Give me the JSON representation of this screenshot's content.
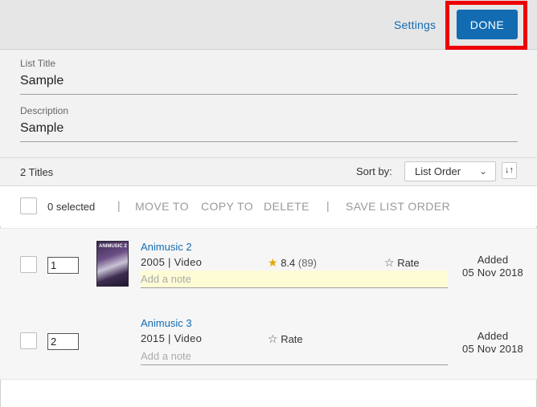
{
  "header": {
    "settings_label": "Settings",
    "done_label": "DONE"
  },
  "list": {
    "title_label": "List Title",
    "title_value": "Sample",
    "description_label": "Description",
    "description_value": "Sample"
  },
  "toolbar": {
    "titles_count": "2 Titles",
    "sort_label": "Sort by:",
    "sort_value": "List Order",
    "sort_dir_icon": "sort-direction-icon"
  },
  "actions": {
    "selected_count": "0 selected",
    "move_to": "MOVE TO",
    "copy_to": "COPY TO",
    "delete": "DELETE",
    "save_order": "SAVE LIST ORDER",
    "separator": "|"
  },
  "items": [
    {
      "order": "1",
      "poster_text": "ANIMUSIC 2",
      "title": "Animusic 2",
      "meta": "2005 | Video",
      "rating": "8.4",
      "votes": "(89)",
      "rate_label": "Rate",
      "note_placeholder": "Add a note",
      "added_label": "Added",
      "added_date": "05 Nov 2018"
    },
    {
      "order": "2",
      "title": "Animusic 3",
      "meta": "2015 | Video",
      "rate_label": "Rate",
      "note_placeholder": "Add a note",
      "added_label": "Added",
      "added_date": "05 Nov 2018"
    }
  ],
  "colors": {
    "accent": "#136cb2",
    "highlight": "#ee0000",
    "star": "#e0a800",
    "note_bg": "#fdfcd5"
  }
}
